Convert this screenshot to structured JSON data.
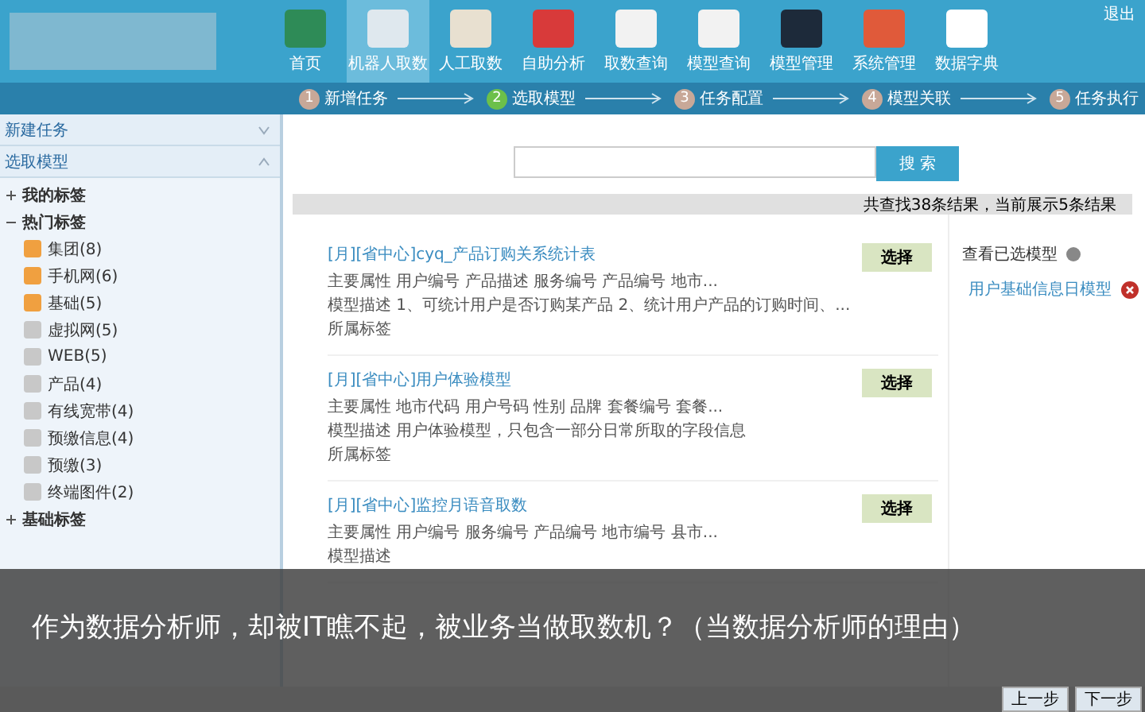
{
  "header": {
    "nav": [
      {
        "label": "首页",
        "selected": false
      },
      {
        "label": "机器人取数",
        "selected": true
      },
      {
        "label": "人工取数",
        "selected": false
      },
      {
        "label": "自助分析",
        "selected": false
      },
      {
        "label": "取数查询",
        "selected": false
      },
      {
        "label": "模型查询",
        "selected": false
      },
      {
        "label": "模型管理",
        "selected": false
      },
      {
        "label": "系统管理",
        "selected": false
      },
      {
        "label": "数据字典",
        "selected": false
      }
    ],
    "logout": "退出"
  },
  "steps": [
    {
      "number": "1",
      "label": "新增任务",
      "selected": false
    },
    {
      "number": "2",
      "label": "选取模型",
      "selected": true
    },
    {
      "number": "3",
      "label": "任务配置",
      "selected": false
    },
    {
      "number": "4",
      "label": "模型关联",
      "selected": false
    },
    {
      "number": "5",
      "label": "任务执行",
      "selected": false
    }
  ],
  "sidebar": {
    "panels": [
      {
        "title": "新建任务",
        "expanded": false
      },
      {
        "title": "选取模型",
        "expanded": true
      }
    ],
    "tree": [
      {
        "label": "我的标签",
        "expanded": false
      },
      {
        "label": "热门标签",
        "expanded": true,
        "children": [
          {
            "label": "集团(8)",
            "color": "#f0a040"
          },
          {
            "label": "手机网(6)",
            "color": "#f0a040"
          },
          {
            "label": "基础(5)",
            "color": "#f0a040"
          },
          {
            "label": "虚拟网(5)",
            "color": "#c8c8c8"
          },
          {
            "label": "WEB(5)",
            "color": "#c8c8c8"
          },
          {
            "label": "产品(4)",
            "color": "#c8c8c8"
          },
          {
            "label": "有线宽带(4)",
            "color": "#c8c8c8"
          },
          {
            "label": "预缴信息(4)",
            "color": "#c8c8c8"
          },
          {
            "label": "预缴(3)",
            "color": "#c8c8c8"
          },
          {
            "label": "终端图件(2)",
            "color": "#c8c8c8"
          }
        ]
      },
      {
        "label": "基础标签",
        "expanded": false
      }
    ]
  },
  "search": {
    "button": "搜 索"
  },
  "result_summary": "共查找38条结果，当前展示5条结果",
  "results": [
    {
      "title": "[月][省中心]cyq_产品订购关系统计表",
      "attributes": "主要属性 用户编号 产品描述 服务编号 产品编号 地市...",
      "description": "模型描述 1、可统计用户是否订购某产品 2、统计用户产品的订购时间、...",
      "tags": "所属标签",
      "button": "选择"
    },
    {
      "title": "[月][省中心]用户体验模型",
      "attributes": "主要属性 地市代码 用户号码 性别 品牌 套餐编号 套餐...",
      "description": "模型描述 用户体验模型，只包含一部分日常所取的字段信息",
      "tags": "所属标签",
      "button": "选择"
    },
    {
      "title": "[月][省中心]监控月语音取数",
      "attributes": "主要属性 用户编号 服务编号 产品编号 地市编号 县市...",
      "description": "模型描述",
      "button": "选择"
    }
  ],
  "selected_models": {
    "title": "查看已选模型",
    "items": [
      "用户基础信息日模型"
    ]
  },
  "caption": "作为数据分析师，却被IT瞧不起，被业务当做取数机？（当数据分析师的理由）",
  "footer": {
    "buttons": [
      "上一步",
      "下一步"
    ]
  }
}
